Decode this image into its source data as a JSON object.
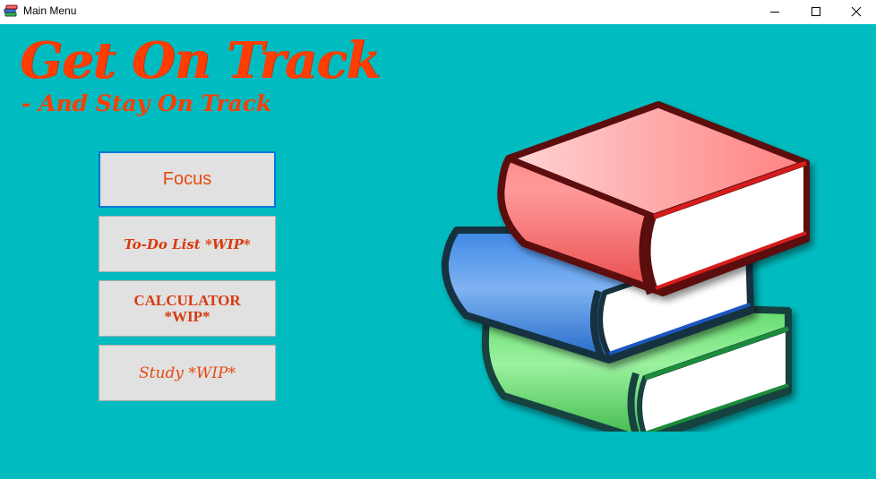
{
  "window": {
    "title": "Main Menu",
    "controls": {
      "minimize": "minimize-icon",
      "maximize": "maximize-icon",
      "close": "close-icon"
    }
  },
  "header": {
    "title": "Get On Track",
    "subtitle": "- And Stay On Track"
  },
  "menu": {
    "buttons": [
      {
        "label": "Focus"
      },
      {
        "label": "To-Do List *WIP*"
      },
      {
        "label": "CALCULATOR *WIP*"
      },
      {
        "label": "Study *WIP*"
      }
    ]
  },
  "illustration": {
    "icon": "books-stack-illustration"
  },
  "colors": {
    "background": "#00BCC0",
    "accent": "#FF3D00",
    "button_bg": "#E1E1E1",
    "focus_border": "#0078D7"
  }
}
